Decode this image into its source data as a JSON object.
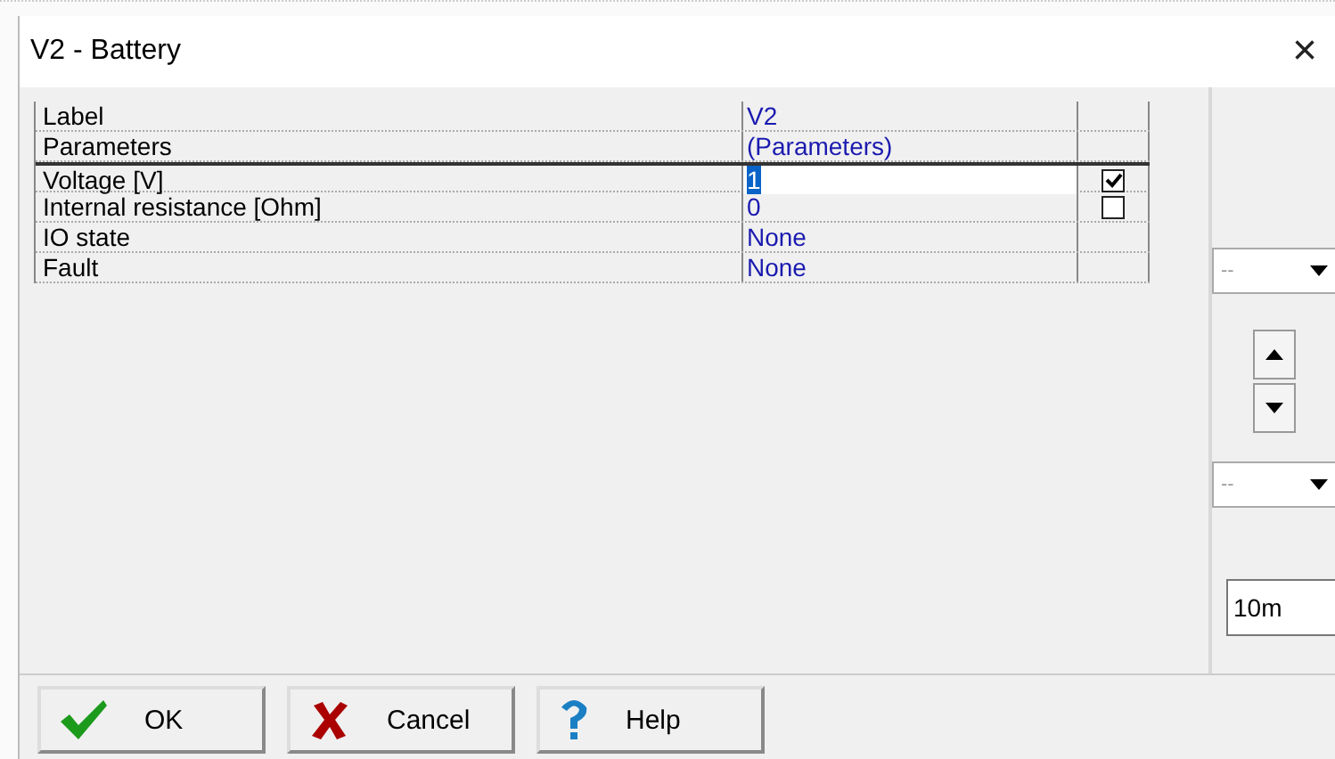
{
  "window": {
    "title": "V2 - Battery",
    "close": "×"
  },
  "grid": {
    "rows": [
      {
        "label": "Label",
        "value": "V2",
        "selected": false
      },
      {
        "label": "Parameters",
        "value": "(Parameters)",
        "selected": false
      },
      {
        "label": "Voltage [V]",
        "value": "1",
        "selected": true,
        "checked": true
      },
      {
        "label": "Internal resistance [Ohm]",
        "value": "0",
        "selected": false,
        "checked": false
      },
      {
        "label": "IO state",
        "value": "None",
        "selected": false
      },
      {
        "label": "Fault",
        "value": "None",
        "selected": false
      }
    ]
  },
  "side": {
    "dropdowns": [
      {
        "value": "--"
      },
      {
        "value": "--"
      }
    ],
    "field": "10m"
  },
  "buttons": [
    {
      "label": "OK",
      "kind": "ok"
    },
    {
      "label": "Cancel",
      "kind": "cancel"
    },
    {
      "label": "Help",
      "kind": "help"
    }
  ]
}
